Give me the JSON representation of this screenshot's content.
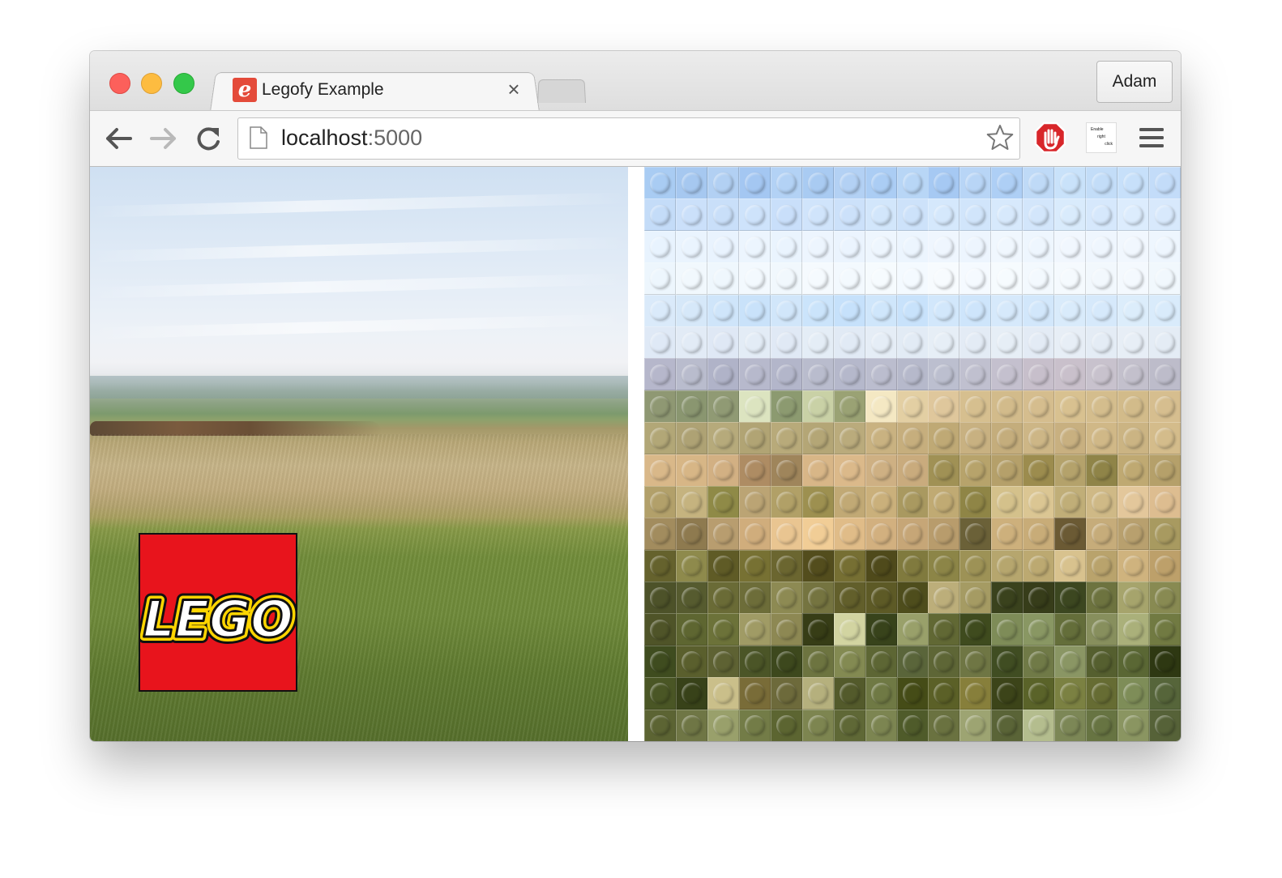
{
  "browser": {
    "tab": {
      "title": "Legofy Example",
      "favicon_glyph": "e",
      "close_glyph": "×"
    },
    "profile_label": "Adam",
    "address": {
      "host": "localhost",
      "port": ":5000"
    },
    "extension_rightclick": {
      "lines": [
        "Enable",
        "right",
        "click"
      ]
    },
    "icons": {
      "back": "back-arrow-icon",
      "forward": "forward-arrow-icon",
      "reload": "reload-icon",
      "page": "page-icon",
      "bookmark": "star-icon",
      "stop_ext": "stop-hand-icon",
      "menu": "hamburger-menu-icon"
    }
  },
  "content": {
    "logo_text": "LEGO",
    "mosaic": {
      "cols": 17,
      "rows": 18,
      "palette_by_row": [
        [
          "#a9ccf3",
          "#a6c8f0",
          "#b2d0f3",
          "#a4c7f2",
          "#b3d2f5",
          "#a9cbf2",
          "#b3d1f4",
          "#abcdf4",
          "#b8d6f6",
          "#a6c9f3",
          "#b8d5f6",
          "#aecff5",
          "#bfdaf7",
          "#c9e2fa",
          "#c3ddf8",
          "#c7e0fa",
          "#c3dcf9"
        ],
        [
          "#c4dcf8",
          "#cbe0fa",
          "#c9dff9",
          "#cee3fb",
          "#c9dffa",
          "#d0e4fb",
          "#cce1fa",
          "#d2e6fb",
          "#cde2fa",
          "#d5e8fc",
          "#d1e5fb",
          "#d7e9fc",
          "#d3e6fb",
          "#d9ebfc",
          "#d6e8fc",
          "#dcecfd",
          "#d8e9fc"
        ],
        [
          "#e8f3fe",
          "#eaf4fe",
          "#e9f3fe",
          "#ecf5fe",
          "#eaf4fe",
          "#edf5fe",
          "#ebf4fe",
          "#eef6fe",
          "#ecf5fe",
          "#eff6fe",
          "#edf5fe",
          "#f0f7fe",
          "#eef6fe",
          "#f1f7fe",
          "#eff6fe",
          "#f1f7fe",
          "#eef6fe"
        ],
        [
          "#edf6fd",
          "#f1f8fd",
          "#eff7fd",
          "#f3f9fe",
          "#f1f8fd",
          "#f5fafe",
          "#f3f9fe",
          "#f6fbfe",
          "#f4faff",
          "#f7fbfe",
          "#f5faff",
          "#f6fbfe",
          "#f3f9fe",
          "#f5fafe",
          "#f2f8fd",
          "#f4f9fe",
          "#f1f8fd"
        ],
        [
          "#daeafa",
          "#d6e8f9",
          "#cfe5fa",
          "#c9e2fa",
          "#d1e6fa",
          "#cbe4fb",
          "#c6e1fb",
          "#cfe6fb",
          "#c8e2fb",
          "#d2e7fb",
          "#cee5fb",
          "#d6e9fb",
          "#d2e7fb",
          "#d9ebfb",
          "#d6e9fb",
          "#dcedfb",
          "#d9ebfb"
        ],
        [
          "#dfe9f6",
          "#e2ebf6",
          "#dfe8f5",
          "#e3ecf6",
          "#e0e9f5",
          "#e4edf6",
          "#e1eaf5",
          "#e5edf6",
          "#e2ebf5",
          "#e6eef6",
          "#e3ebf5",
          "#e6eef6",
          "#e3ebf5",
          "#e7eef6",
          "#e4ecf5",
          "#e7eef6",
          "#e4ecf5"
        ],
        [
          "#b6b7cb",
          "#b9bccd",
          "#b0b3c8",
          "#b7b9cc",
          "#b3b6ca",
          "#b9bccd",
          "#b5b8cb",
          "#bbbdce",
          "#b6b9cb",
          "#bcbfcf",
          "#c0c0cf",
          "#c4c0ce",
          "#c7bfcb",
          "#c9c0cb",
          "#c8c2cd",
          "#c3c0cc",
          "#bdbcca"
        ],
        [
          "#8f9873",
          "#8a9670",
          "#909a74",
          "#dce4c0",
          "#8c9a70",
          "#c9d1a6",
          "#9aa274",
          "#f4e8c3",
          "#e3cfa3",
          "#dfc79c",
          "#d6bf8f",
          "#d2bb8b",
          "#d5bd8e",
          "#d8c190",
          "#d4bd8d",
          "#d2bb8a",
          "#d6be8f"
        ],
        [
          "#b2a777",
          "#aea274",
          "#b6aa7b",
          "#b1a474",
          "#b8aa7a",
          "#b4a676",
          "#baab7c",
          "#c9b281",
          "#c6ae7d",
          "#bfa975",
          "#c8b181",
          "#c4ad7c",
          "#cdb686",
          "#c8b080",
          "#d0b887",
          "#cbb483",
          "#d4bc8b"
        ],
        [
          "#d9b889",
          "#d7b686",
          "#d2b083",
          "#ae8c63",
          "#9f855b",
          "#d8b687",
          "#dbb98a",
          "#ceb083",
          "#c9ab7d",
          "#a09155",
          "#b7a36b",
          "#b5a06a",
          "#9c8c4e",
          "#b4a26b",
          "#8f8448",
          "#bfa972",
          "#b5a06a"
        ],
        [
          "#b2a06a",
          "#c5b37f",
          "#8f8a47",
          "#bba474",
          "#b1a067",
          "#9d9050",
          "#c1a975",
          "#cab07b",
          "#a99960",
          "#c0aa73",
          "#8f8546",
          "#d4c18b",
          "#dbc693",
          "#c0ae78",
          "#cfb986",
          "#e3c79b",
          "#ddbd90"
        ],
        [
          "#a28c5e",
          "#8e7a4f",
          "#b89d6f",
          "#d0ad7c",
          "#e9c591",
          "#f1cd96",
          "#e0bc88",
          "#d2b07f",
          "#c6a677",
          "#b89c6c",
          "#6b6138",
          "#cdb07c",
          "#c8ac78",
          "#6b5a34",
          "#c6ac7a",
          "#b8a06e",
          "#a89a60"
        ],
        [
          "#65622d",
          "#8e8a4c",
          "#5f5b26",
          "#777133",
          "#6b6630",
          "#534d1d",
          "#766f33",
          "#4f4a1b",
          "#807a3e",
          "#8c8547",
          "#9d9256",
          "#b6a66e",
          "#bca971",
          "#d8c28e",
          "#b9a36c",
          "#cfb37e",
          "#bda06a"
        ],
        [
          "#4d5229",
          "#565b2f",
          "#6a6b36",
          "#6d6d39",
          "#8d8a53",
          "#757440",
          "#625f2b",
          "#5d5a26",
          "#4e4d1c",
          "#bcae7a",
          "#a59b63",
          "#3a421d",
          "#373d1a",
          "#3c4720",
          "#6d733f",
          "#a6a46c",
          "#888a52"
        ],
        [
          "#4f5428",
          "#5e6631",
          "#6c7239",
          "#a09b65",
          "#8d8853",
          "#373d16",
          "#d2d4a1",
          "#38431b",
          "#99a06a",
          "#616834",
          "#3f4b1e",
          "#7e8c58",
          "#899763",
          "#646e3a",
          "#878f5d",
          "#aab07a",
          "#717a42"
        ],
        [
          "#3f4c1f",
          "#5a5f2d",
          "#5e6233",
          "#4b5527",
          "#3d481d",
          "#6d7440",
          "#838a52",
          "#5d6634",
          "#5a653a",
          "#5e6636",
          "#6f7644",
          "#404d22",
          "#707a47",
          "#8a9664",
          "#555f2f",
          "#5a6734",
          "#2e3812"
        ],
        [
          "#4a5625",
          "#384219",
          "#cabf8a",
          "#796c38",
          "#6d6a3b",
          "#b5b07d",
          "#535a2b",
          "#6f7944",
          "#454c17",
          "#5b6027",
          "#877f3b",
          "#3c4419",
          "#5a6329",
          "#7b8142",
          "#666c33",
          "#7e8d58",
          "#56653a"
        ],
        [
          "#5c6433",
          "#6f7645",
          "#99a06b",
          "#737c47",
          "#5c6531",
          "#7d8550",
          "#5f6836",
          "#7c8551",
          "#4f5b2a",
          "#6a7240",
          "#9da472",
          "#5a6437",
          "#b4bd8e",
          "#7c8756",
          "#677442",
          "#8a9561",
          "#566238"
        ]
      ]
    }
  }
}
